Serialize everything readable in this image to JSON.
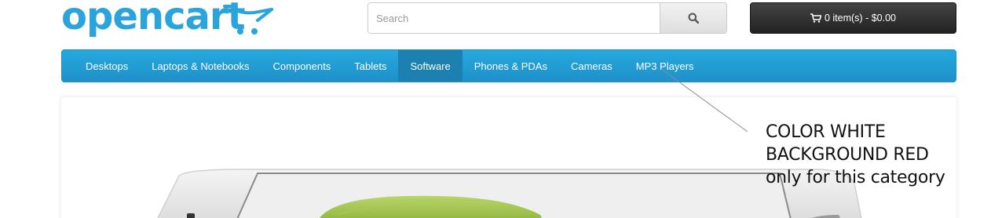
{
  "brand": {
    "logo_text": "opencart",
    "accent_color": "#2ba4dc",
    "logo_icon": "cart-dots-icon"
  },
  "search": {
    "placeholder": "Search",
    "value": "",
    "button_icon": "search-icon"
  },
  "cart": {
    "icon": "shopping-cart-icon",
    "label": "0 item(s) - $0.00"
  },
  "menu": {
    "background_color": "#229cd4",
    "active_color": "#1c80b0",
    "items": [
      {
        "label": "Desktops"
      },
      {
        "label": "Laptops & Notebooks"
      },
      {
        "label": "Components"
      },
      {
        "label": "Tablets"
      },
      {
        "label": "Software",
        "active": true
      },
      {
        "label": "Phones & PDAs"
      },
      {
        "label": "Cameras"
      },
      {
        "label": "MP3 Players"
      }
    ]
  },
  "slideshow": {
    "image": "phone-with-cucumber-banner"
  },
  "annotation": {
    "lines": [
      "COLOR WHITE",
      "BACKGROUND RED",
      "only for this category"
    ]
  }
}
